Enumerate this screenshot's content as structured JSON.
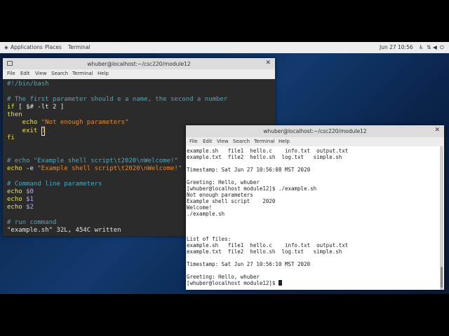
{
  "topbar": {
    "applications": "Applications",
    "places": "Places",
    "terminal": "Terminal",
    "datetime": "Jun 27  10:56"
  },
  "vim_window": {
    "title": "whuber@localhost:~/csc220/module12",
    "menu": [
      "File",
      "Edit",
      "View",
      "Search",
      "Terminal",
      "Help"
    ],
    "lines": {
      "shebang": "#!/bin/bash",
      "comment1": "# The first parameter should e a name, the second a number",
      "if_kw": "if",
      "if_rest": " [ $# -lt 2 ]",
      "then_kw": "then",
      "echo_kw": "    echo",
      "echo_str": " \"Not enough parameters\"",
      "exit_kw": "    exit",
      "exit_val": "1",
      "fi_kw": "fi",
      "comment2": "# echo \"Example shell script\\t2020\\nWelcome!\"",
      "echo_e_kw": "echo",
      "echo_e_opt": " -e",
      "echo_e_str": " \"Example shell script\\t2020\\nWelcome!\"",
      "comment3": "# Command line parameters",
      "echo0_kw": "echo",
      "echo0_var": " $0",
      "echo1_kw": "echo",
      "echo1_var": " $1",
      "echo2_kw": "echo",
      "echo2_var": " $2",
      "comment4": "# run command",
      "status": "\"example.sh\" 32L, 454C written"
    }
  },
  "terminal_window": {
    "title": "whuber@localhost:~/csc220/module12",
    "menu": [
      "File",
      "Edit",
      "View",
      "Search",
      "Terminal",
      "Help"
    ],
    "lines": [
      "example.sh   file1  hello.c    info.txt  output.txt",
      "example.txt  file2  hello.sh  log.txt   simple.sh",
      "",
      "Timestamp: Sat Jun 27 10:56:08 MST 2020",
      "",
      "Greeting: Hello, whuber",
      "[whuber@localhost module12]$ ./example.sh",
      "Not enough parameters",
      "Example shell script    2020",
      "Welcome!",
      "./example.sh",
      "",
      "",
      "",
      "List of files:",
      "example.sh   file1  hello.c    info.txt  output.txt",
      "example.txt  file2  hello.sh  log.txt   simple.sh",
      "",
      "Timestamp: Sat Jun 27 10:56:10 MST 2020",
      "",
      "Greeting: Hello, whuber",
      "[whuber@localhost module12]$ "
    ]
  },
  "colors": {
    "vim_bg": "#2b2b2b",
    "term_bg": "#ffffff",
    "comment": "#4aa8c0",
    "keyword": "#e8e25a",
    "string": "#e08a3a",
    "variable": "#c0a0ff"
  }
}
